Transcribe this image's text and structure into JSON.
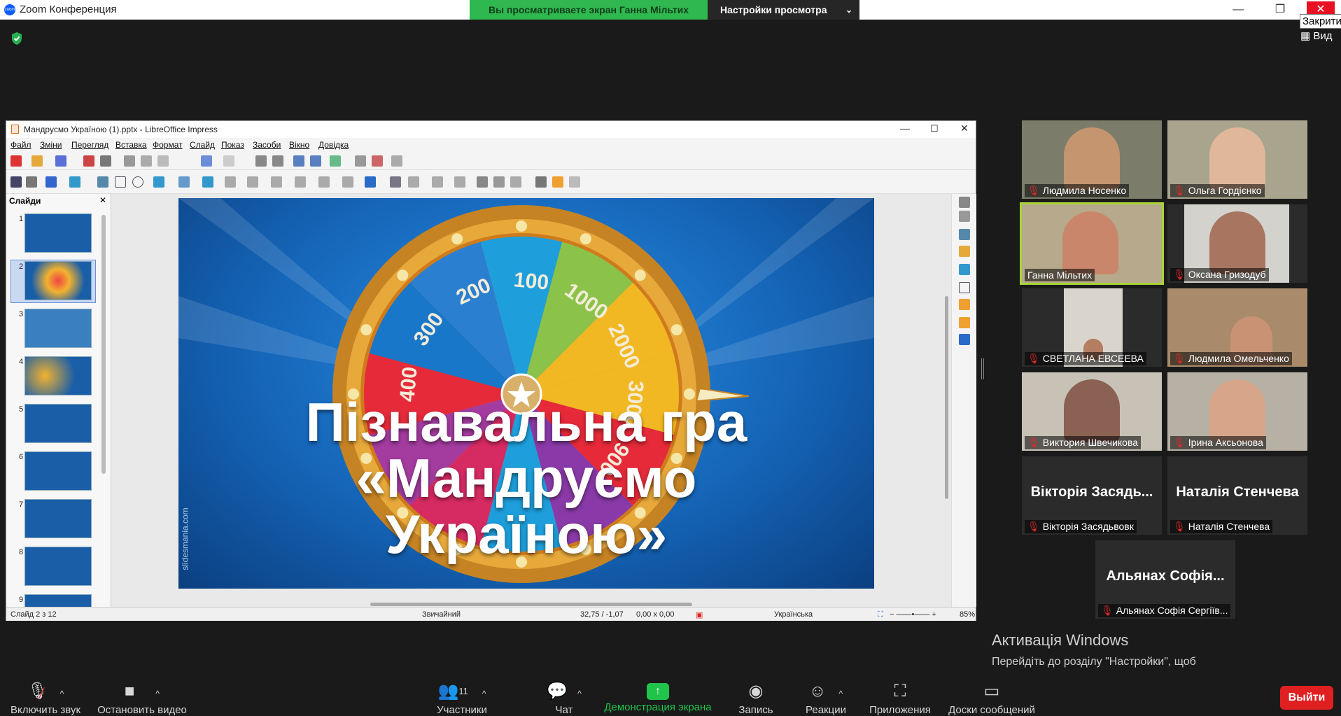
{
  "zoom": {
    "title": "Zoom Конференция",
    "share_banner": "Вы просматриваете экран Ганна Мільтих",
    "view_options": "Настройки просмотра",
    "close_tooltip": "Закрити",
    "view_label": "Вид",
    "leave": "Выйти"
  },
  "impress": {
    "title": "Мандрусмо Україною (1).pptx - LibreOffice Impress",
    "menu": [
      "Файл",
      "Зміни",
      "Перегляд",
      "Вставка",
      "Формат",
      "Слайд",
      "Показ",
      "Засоби",
      "Вікно",
      "Довідка"
    ],
    "slides_header": "Слайди",
    "slide_numbers": [
      "1",
      "2",
      "3",
      "4",
      "5",
      "6",
      "7",
      "8",
      "9"
    ],
    "status": {
      "slide": "Слайд 2 з 12",
      "layout": "Звичайний",
      "position": "32,75 / -1,07",
      "size": "0,00 x 0,00",
      "language": "Українська",
      "zoom": "85%"
    }
  },
  "slide": {
    "line1": "Пізнавальна  гра",
    "line2": "«Мандруємо",
    "line3": "Україною»",
    "wheel_values": [
      "100",
      "1000",
      "2000",
      "3000",
      "900",
      "200",
      "300",
      "400"
    ],
    "watermark": "slidesmania.com"
  },
  "participants": [
    {
      "name": "Людмила Носенко",
      "muted": true
    },
    {
      "name": "Ольга Гордієнко",
      "muted": true
    },
    {
      "name": "Ганна Мільтих",
      "muted": false,
      "active": true
    },
    {
      "name": "Оксана Гризодуб",
      "muted": true
    },
    {
      "name": "СВЕТЛАНА ЕВСЕЕВА",
      "muted": true
    },
    {
      "name": "Людмила Омельченко",
      "muted": true
    },
    {
      "name": "Виктория Швечикова",
      "muted": true
    },
    {
      "name": "Ірина Аксьонова",
      "muted": true
    },
    {
      "name": "Вікторія Засядьвовк",
      "muted": true,
      "big": "Вікторія Засядь..."
    },
    {
      "name": "Наталія Стенчева",
      "muted": true,
      "big": "Наталія Стенчева"
    },
    {
      "name": "Альянах Софія Сергіїв...",
      "muted": true,
      "big": "Альянах Софія..."
    }
  ],
  "windows_activation": {
    "title": "Активація Windows",
    "text": "Перейдіть до розділу \"Настройки\", щоб активувати Windows."
  },
  "bottombar": {
    "mute": "Включить звук",
    "video": "Остановить видео",
    "participants": "Участники",
    "participants_count": "11",
    "chat": "Чат",
    "share": "Демонстрация экрана",
    "record": "Запись",
    "reactions": "Реакции",
    "apps": "Приложения",
    "whiteboards": "Доски сообщений"
  }
}
